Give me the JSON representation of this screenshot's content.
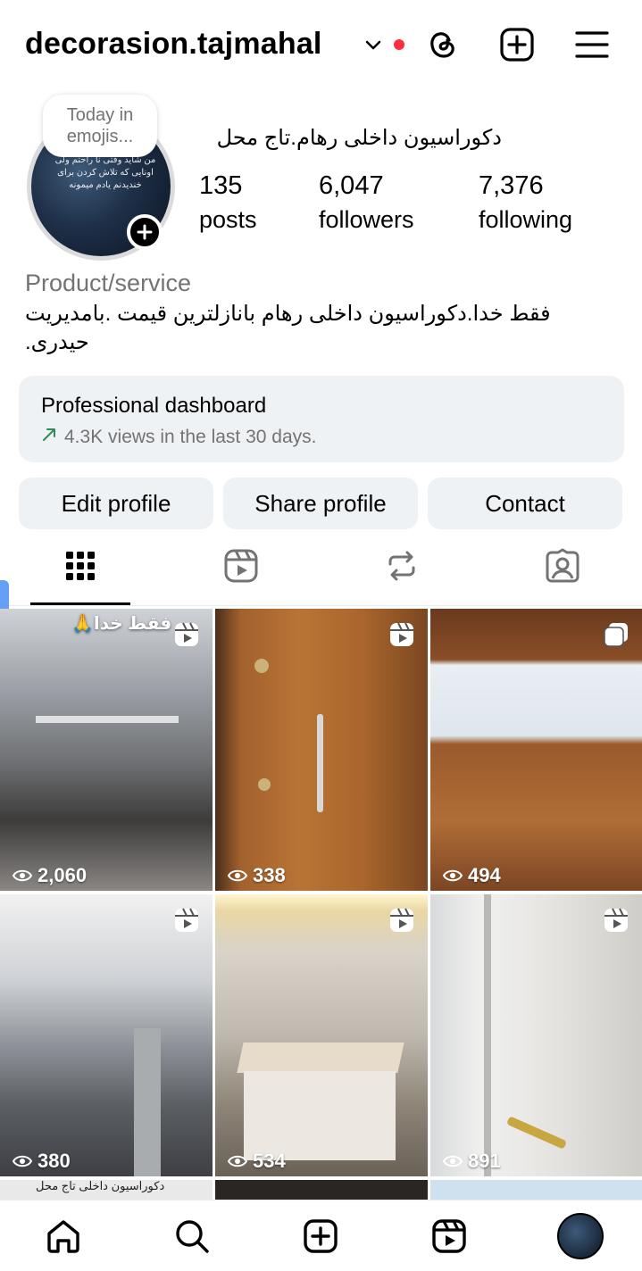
{
  "header": {
    "username": "decorasion.tajmahal",
    "icons": [
      "chevron-down-icon",
      "notification-dot",
      "threads-icon",
      "create-icon",
      "menu-icon"
    ]
  },
  "profile": {
    "note": "Today in emojis...",
    "avatar_text": "من شاید وقتی نا راحتم ولی اونایی که تلاش کردن برای خندیدنم یادم میمونه",
    "display_name": "دکوراسیون داخلی رهام.تاج محل",
    "stats": [
      {
        "value": "135",
        "label": "posts"
      },
      {
        "value": "6,047",
        "label": "followers"
      },
      {
        "value": "7,376",
        "label": "following"
      }
    ],
    "category": "Product/service",
    "bio": "فقط خدا.دکوراسیون داخلی رهام بانازلترین قیمت .بامدیریت حیدری."
  },
  "dashboard": {
    "title": "Professional dashboard",
    "subtitle": "4.3K views in the last 30 days."
  },
  "buttons": {
    "edit": "Edit profile",
    "share": "Share profile",
    "contact": "Contact"
  },
  "tabs": [
    "grid-icon",
    "reels-icon",
    "reposts-icon",
    "tagged-icon"
  ],
  "grid": [
    {
      "views": "2,060",
      "type": "reel",
      "caption": "فقط خدا🙏"
    },
    {
      "views": "338",
      "type": "reel"
    },
    {
      "views": "494",
      "type": "carousel"
    },
    {
      "views": "380",
      "type": "reel"
    },
    {
      "views": "534",
      "type": "reel"
    },
    {
      "views": "891",
      "type": "reel"
    }
  ],
  "grid_partial_caption": "دکوراسیون داخلی تاج محل",
  "bottom_nav": [
    "home-icon",
    "search-icon",
    "create-icon",
    "reels-icon",
    "profile-avatar"
  ],
  "colors": {
    "accent_red": "#ff2d3d",
    "button_bg": "#eff2f5",
    "muted_text": "#737373",
    "trend_green": "#2e8b57"
  }
}
